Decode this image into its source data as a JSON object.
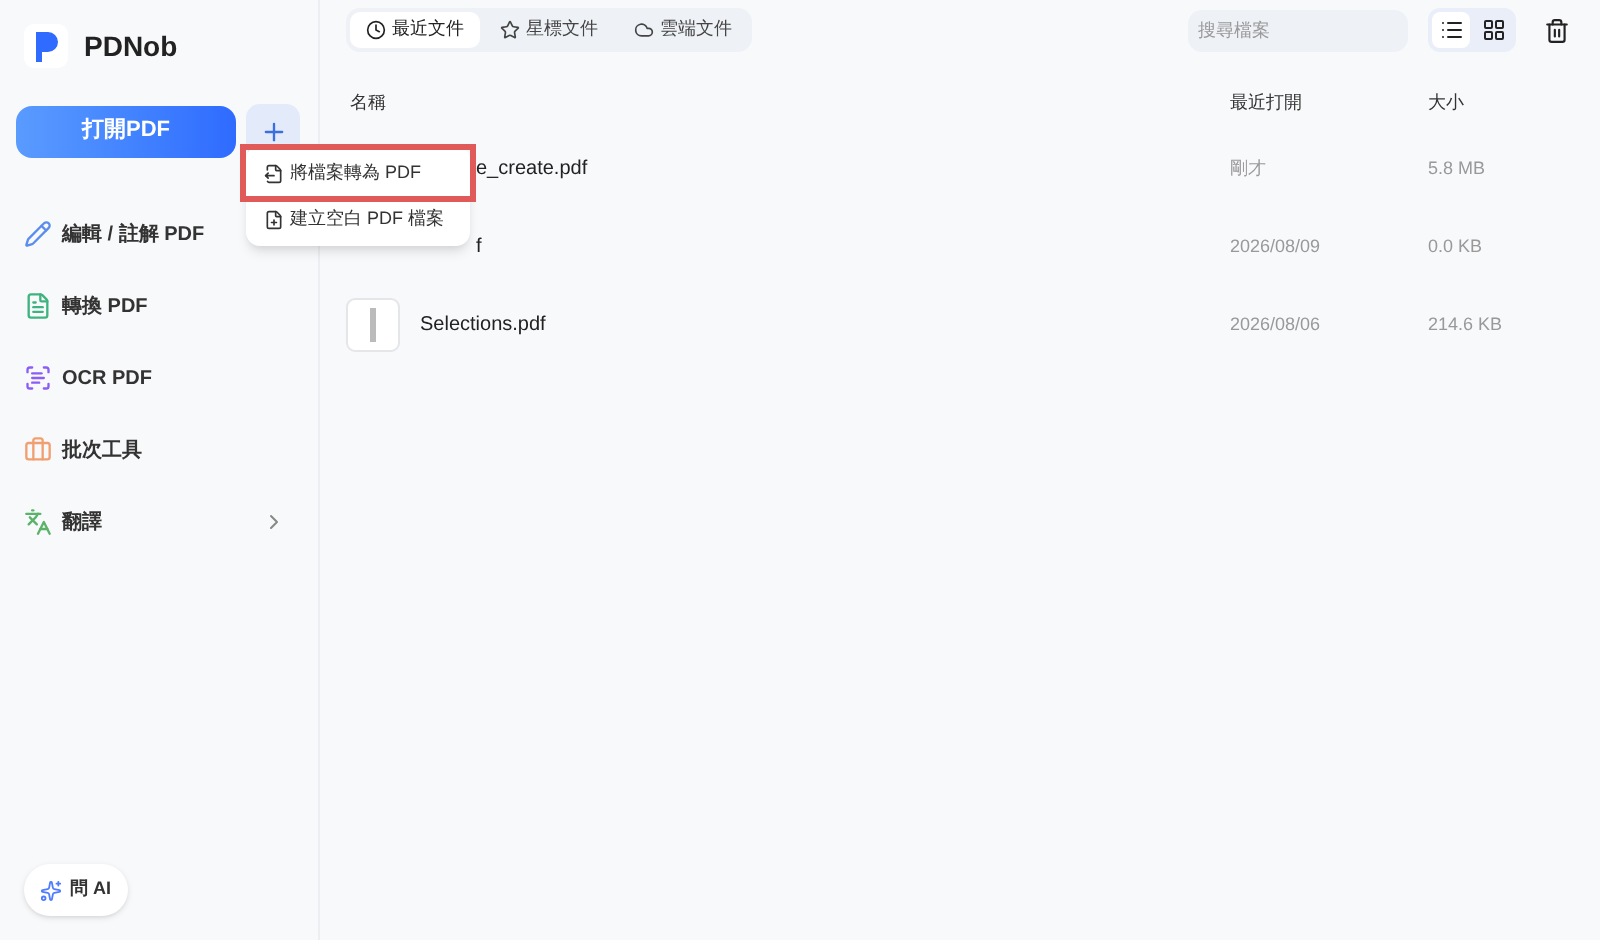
{
  "app": {
    "name": "PDNob"
  },
  "sidebar": {
    "open_button": "打開PDF",
    "items": [
      {
        "label": "編輯 / 註解 PDF",
        "kind": "edit"
      },
      {
        "label": "轉換 PDF",
        "kind": "convert"
      },
      {
        "label": "OCR PDF",
        "kind": "ocr"
      },
      {
        "label": "批次工具",
        "kind": "batch"
      },
      {
        "label": "翻譯",
        "kind": "translate",
        "has_submenu": true
      }
    ],
    "ask_ai": "問 AI"
  },
  "add_menu": {
    "items": [
      {
        "label": "將檔案轉為 PDF",
        "highlighted": true
      },
      {
        "label": "建立空白 PDF 檔案",
        "highlighted": false
      }
    ]
  },
  "tabs": [
    {
      "label": "最近文件",
      "selected": true
    },
    {
      "label": "星標文件",
      "selected": false
    },
    {
      "label": "雲端文件",
      "selected": false
    }
  ],
  "search": {
    "placeholder": "搜尋檔案"
  },
  "view_modes": [
    {
      "kind": "list",
      "selected": true
    },
    {
      "kind": "grid",
      "selected": false
    }
  ],
  "table": {
    "columns": [
      "名稱",
      "最近打開",
      "大小"
    ],
    "rows": [
      {
        "name": "e_create.pdf",
        "partly_covered": true,
        "opened": "剛才",
        "size": "5.8 MB"
      },
      {
        "name": "f",
        "partly_covered": true,
        "opened": "2026/08/09",
        "size": "0.0 KB"
      },
      {
        "name": "Selections.pdf",
        "partly_covered": false,
        "opened": "2026/08/06",
        "size": "214.6 KB"
      }
    ]
  }
}
